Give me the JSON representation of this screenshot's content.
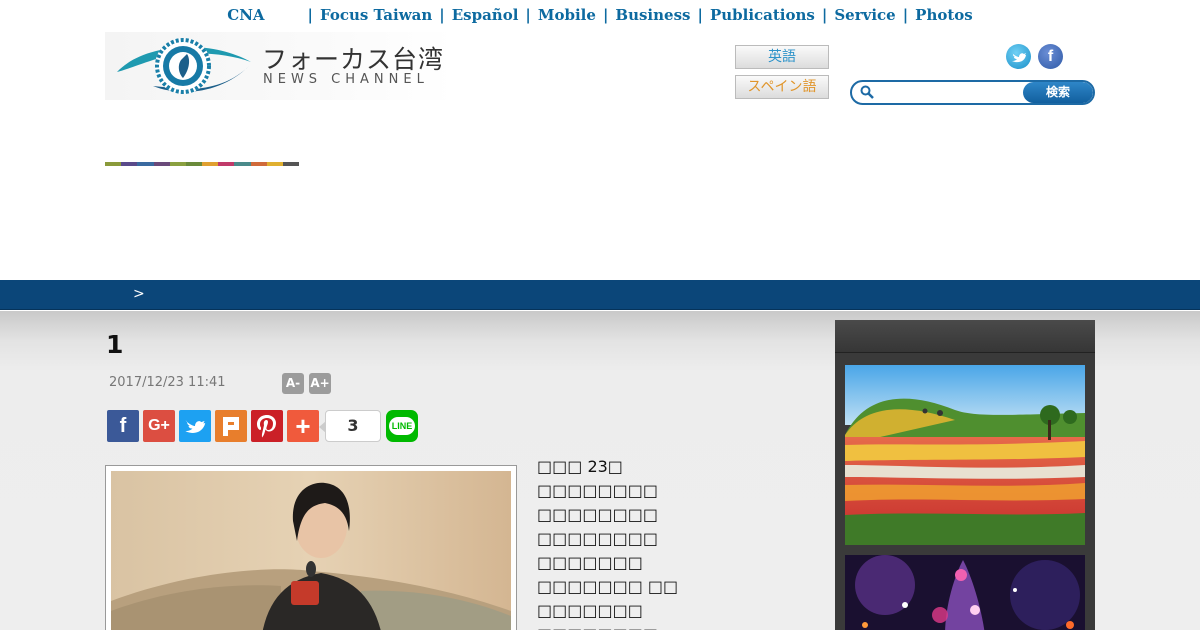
{
  "topnav": {
    "items": [
      "CNA",
      "Focus Taiwan",
      "Español",
      "Mobile",
      "Business",
      "Publications",
      "Service",
      "Photos"
    ],
    "separator": "|"
  },
  "header": {
    "logo_jp": "フォーカス台湾",
    "logo_en": "NEWS CHANNEL",
    "lang_english": "英語",
    "lang_spanish": "スペイン語",
    "search_placeholder": "",
    "search_button": "検索"
  },
  "stripe_colors": [
    "#8a9a3a",
    "#5a4a8a",
    "#3a6aa0",
    "#6a4a7a",
    "#8aa040",
    "#6a8a3a",
    "#e0a030",
    "#c03a6a",
    "#4a8a8a",
    "#d06a3a",
    "#e0b030",
    "#555555"
  ],
  "breadcrumb": {
    "text": ">"
  },
  "article": {
    "title": "1",
    "date": "2017/12/23 11:41",
    "font_decrease": "A-",
    "font_increase": "A+",
    "share_count": "3",
    "body_lines": [
      "□□□ 23□",
      "□□□□□□□□",
      "□□□□□□□□",
      "□□□□□□□□",
      "□□□□□□□",
      "□□□□□□□ □□",
      "□□□□□□□",
      "□□□□□□□□"
    ]
  },
  "share_icons": [
    "facebook-icon",
    "google-plus-icon",
    "twitter-icon",
    "plurk-icon",
    "pinterest-icon",
    "addthis-icon",
    "line-icon"
  ],
  "colors": {
    "nav_link": "#0d6aa0",
    "breadcrumb_bar": "#0b4679",
    "sidebar": "#3a3a3a"
  }
}
